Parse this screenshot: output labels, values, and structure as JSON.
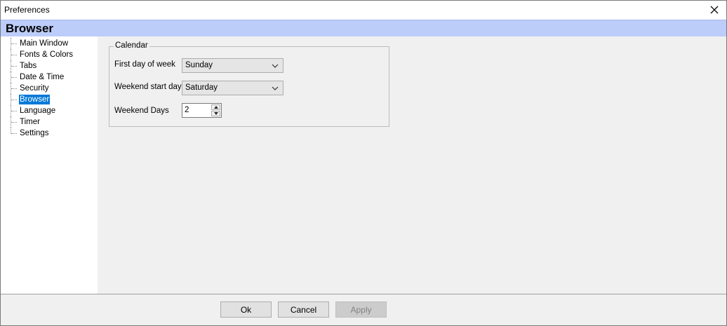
{
  "window": {
    "title": "Preferences"
  },
  "header": {
    "section_title": "Browser"
  },
  "tree": {
    "items": [
      {
        "label": "Main Window"
      },
      {
        "label": "Fonts & Colors"
      },
      {
        "label": "Tabs"
      },
      {
        "label": "Date & Time"
      },
      {
        "label": "Security"
      },
      {
        "label": "Browser"
      },
      {
        "label": "Language"
      },
      {
        "label": "Timer"
      },
      {
        "label": "Settings"
      }
    ],
    "selected": "Browser"
  },
  "calendar": {
    "group_label": "Calendar",
    "first_day_label": "First day of week",
    "first_day_value": "Sunday",
    "weekend_start_label": "Weekend start day",
    "weekend_start_value": "Saturday",
    "weekend_days_label": "Weekend Days",
    "weekend_days_value": "2"
  },
  "footer": {
    "ok_label": "Ok",
    "cancel_label": "Cancel",
    "apply_label": "Apply"
  },
  "icons": {
    "close": "close-icon",
    "dropdown": "chevron-down-icon",
    "spin_up": "spin-up-icon",
    "spin_down": "spin-down-icon"
  },
  "colors": {
    "header_band": "#bccdfa",
    "selection": "#0078d7"
  }
}
